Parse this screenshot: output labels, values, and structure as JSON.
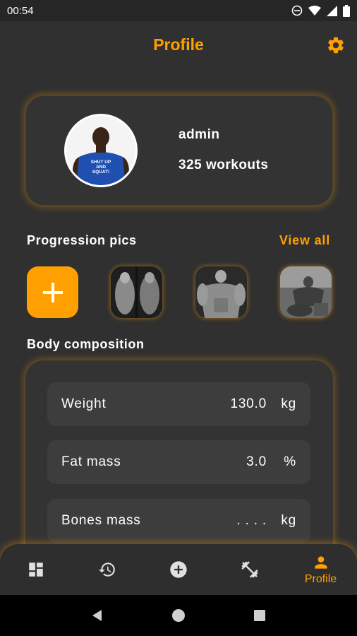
{
  "status_bar": {
    "time": "00:54"
  },
  "header": {
    "title": "Profile"
  },
  "profile": {
    "username": "admin",
    "workouts": "325 workouts",
    "avatar_shirt_text": "SHUT UP AND SQUAT!"
  },
  "progression": {
    "title": "Progression pics",
    "view_all": "View all"
  },
  "body_composition": {
    "title": "Body composition",
    "rows": [
      {
        "label": "Weight",
        "value": "130.0",
        "unit": "kg"
      },
      {
        "label": "Fat mass",
        "value": "3.0",
        "unit": "%"
      },
      {
        "label": "Bones mass",
        "value": ". . . .",
        "unit": "kg"
      }
    ]
  },
  "bottom_nav": {
    "items": [
      {
        "icon": "dashboard-icon",
        "label": ""
      },
      {
        "icon": "history-icon",
        "label": ""
      },
      {
        "icon": "add-circle-icon",
        "label": ""
      },
      {
        "icon": "fitness-center-icon",
        "label": ""
      },
      {
        "icon": "person-icon",
        "label": "Profile"
      }
    ]
  },
  "colors": {
    "accent": "#ffa000",
    "background": "#303030",
    "card": "#333333",
    "row": "#3d3d3d"
  }
}
